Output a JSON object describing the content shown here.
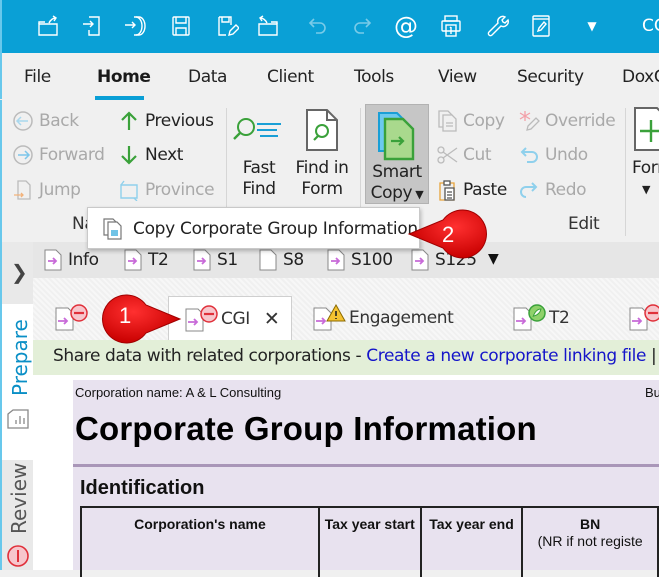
{
  "titlebar": {
    "title": "CG",
    "quick_access": [
      {
        "icon": "open-folder-icon"
      },
      {
        "icon": "import-icon"
      },
      {
        "icon": "rollforward-icon"
      },
      {
        "icon": "save-icon"
      },
      {
        "icon": "save-as-icon"
      },
      {
        "icon": "open-recent-icon"
      },
      {
        "icon": "undo-icon",
        "disabled": true
      },
      {
        "icon": "redo-icon",
        "disabled": true
      },
      {
        "icon": "email-icon"
      },
      {
        "icon": "print-icon"
      },
      {
        "icon": "wrench-icon"
      },
      {
        "icon": "edit-form-icon"
      },
      {
        "icon": "customize-dropdown-icon"
      }
    ]
  },
  "menu": {
    "items": [
      "File",
      "Home",
      "Data",
      "Client",
      "Tools",
      "View",
      "Security",
      "DoxC"
    ],
    "active": "Home"
  },
  "ribbon": {
    "navigate": {
      "back": "Back",
      "forward": "Forward",
      "jump": "Jump",
      "previous": "Previous",
      "next": "Next",
      "province": "Province",
      "group_label": "Na"
    },
    "find": {
      "fast_find": [
        "Fast",
        "Find"
      ],
      "find_in_form": [
        "Find in",
        "Form"
      ]
    },
    "smart_copy": [
      "Smart",
      "Copy"
    ],
    "edit": {
      "copy": "Copy",
      "cut": "Cut",
      "paste": "Paste",
      "override": "Override",
      "undo": "Undo",
      "redo": "Redo",
      "group_label": "Edit"
    },
    "form": "Form"
  },
  "popup": {
    "item": "Copy Corporate Group Information"
  },
  "form_bar": {
    "items": [
      "Info",
      "T2",
      "S1",
      "S8",
      "S100",
      "S125"
    ]
  },
  "sidebar": {
    "prepare": "Prepare",
    "review": "Review"
  },
  "tabs": [
    {
      "label": "",
      "status": "error"
    },
    {
      "label": "CGI",
      "status": "error",
      "active": true
    },
    {
      "label": "Engagement",
      "status": "warning"
    },
    {
      "label": "T2",
      "status": "ok"
    },
    {
      "label": "",
      "status": "error"
    }
  ],
  "infobar": {
    "text": "Share data with related corporations - ",
    "link": "Create a new corporate linking file",
    "sep": " | ",
    "more": "I"
  },
  "document": {
    "corp_name": "Corporation name: A & L Consulting",
    "bu": "Bu",
    "title": "Corporate Group Information",
    "section": "Identification",
    "columns": [
      {
        "label": "Corporation's name",
        "sub": ""
      },
      {
        "label": "Tax year start",
        "sub": ""
      },
      {
        "label": "Tax year end",
        "sub": ""
      },
      {
        "label": "BN",
        "sub": "(NR if not registe"
      }
    ]
  },
  "callouts": [
    "1",
    "2"
  ],
  "colors": {
    "titlebar": "#0aa0d6",
    "accent_green": "#3aa13a",
    "callout_red": "#e00000",
    "link_blue": "#1515c9",
    "infobar_bg": "#e3efd8",
    "doc_bg": "#e8e2ef"
  }
}
